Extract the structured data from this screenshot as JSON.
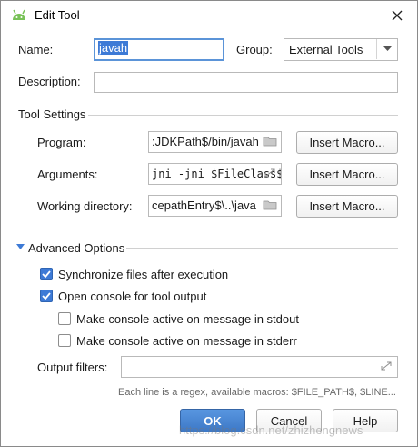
{
  "window": {
    "title": "Edit Tool"
  },
  "name": {
    "label": "Name:",
    "value": "javah"
  },
  "group": {
    "label": "Group:",
    "value": "External Tools"
  },
  "description": {
    "label": "Description:",
    "value": ""
  },
  "tool_settings": {
    "title": "Tool Settings",
    "program": {
      "label": "Program:",
      "value": ":JDKPath$/bin/javah"
    },
    "arguments": {
      "label": "Arguments:",
      "value": "jni -jni $FileClass$"
    },
    "working_directory": {
      "label": "Working directory:",
      "value": "cepathEntry$\\..\\java"
    },
    "insert_macro_label": "Insert Macro..."
  },
  "advanced": {
    "title": "Advanced Options",
    "sync_files": {
      "label": "Synchronize files after execution",
      "checked": true
    },
    "open_console": {
      "label": "Open console for tool output",
      "checked": true
    },
    "console_stdout": {
      "label": "Make console active on message in stdout",
      "checked": false
    },
    "console_stderr": {
      "label": "Make console active on message in stderr",
      "checked": false
    },
    "output_filters": {
      "label": "Output filters:",
      "value": ""
    },
    "hint": "Each line is a regex, available macros: $FILE_PATH$, $LINE..."
  },
  "buttons": {
    "ok": "OK",
    "cancel": "Cancel",
    "help": "Help"
  },
  "watermark": "https://blog.csdn.net/zhizhengnews",
  "colors": {
    "accent": "#3d7ad6",
    "focus_border": "#5b94d8",
    "android_green": "#78c257"
  },
  "icons": {
    "app": "android-icon",
    "close": "close-icon",
    "folder": "folder-icon",
    "expand": "expand-icon",
    "dropdown": "chevron-down-icon",
    "triangle": "triangle-down-icon"
  }
}
